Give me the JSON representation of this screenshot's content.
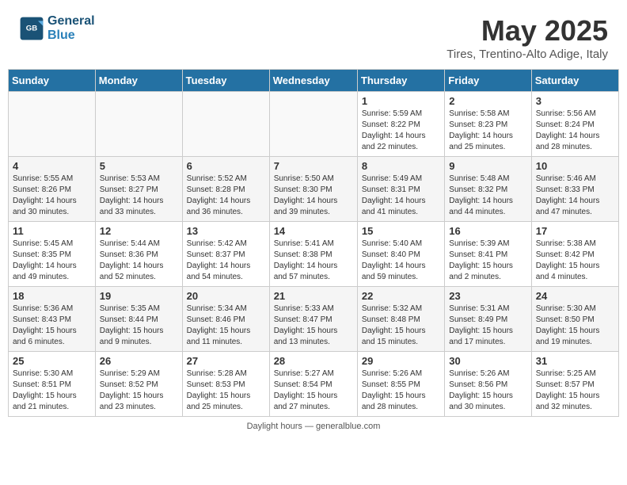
{
  "header": {
    "logo_line1": "General",
    "logo_line2": "Blue",
    "month_year": "May 2025",
    "location": "Tires, Trentino-Alto Adige, Italy"
  },
  "weekdays": [
    "Sunday",
    "Monday",
    "Tuesday",
    "Wednesday",
    "Thursday",
    "Friday",
    "Saturday"
  ],
  "weeks": [
    [
      {
        "day": "",
        "info": ""
      },
      {
        "day": "",
        "info": ""
      },
      {
        "day": "",
        "info": ""
      },
      {
        "day": "",
        "info": ""
      },
      {
        "day": "1",
        "info": "Sunrise: 5:59 AM\nSunset: 8:22 PM\nDaylight: 14 hours\nand 22 minutes."
      },
      {
        "day": "2",
        "info": "Sunrise: 5:58 AM\nSunset: 8:23 PM\nDaylight: 14 hours\nand 25 minutes."
      },
      {
        "day": "3",
        "info": "Sunrise: 5:56 AM\nSunset: 8:24 PM\nDaylight: 14 hours\nand 28 minutes."
      }
    ],
    [
      {
        "day": "4",
        "info": "Sunrise: 5:55 AM\nSunset: 8:26 PM\nDaylight: 14 hours\nand 30 minutes."
      },
      {
        "day": "5",
        "info": "Sunrise: 5:53 AM\nSunset: 8:27 PM\nDaylight: 14 hours\nand 33 minutes."
      },
      {
        "day": "6",
        "info": "Sunrise: 5:52 AM\nSunset: 8:28 PM\nDaylight: 14 hours\nand 36 minutes."
      },
      {
        "day": "7",
        "info": "Sunrise: 5:50 AM\nSunset: 8:30 PM\nDaylight: 14 hours\nand 39 minutes."
      },
      {
        "day": "8",
        "info": "Sunrise: 5:49 AM\nSunset: 8:31 PM\nDaylight: 14 hours\nand 41 minutes."
      },
      {
        "day": "9",
        "info": "Sunrise: 5:48 AM\nSunset: 8:32 PM\nDaylight: 14 hours\nand 44 minutes."
      },
      {
        "day": "10",
        "info": "Sunrise: 5:46 AM\nSunset: 8:33 PM\nDaylight: 14 hours\nand 47 minutes."
      }
    ],
    [
      {
        "day": "11",
        "info": "Sunrise: 5:45 AM\nSunset: 8:35 PM\nDaylight: 14 hours\nand 49 minutes."
      },
      {
        "day": "12",
        "info": "Sunrise: 5:44 AM\nSunset: 8:36 PM\nDaylight: 14 hours\nand 52 minutes."
      },
      {
        "day": "13",
        "info": "Sunrise: 5:42 AM\nSunset: 8:37 PM\nDaylight: 14 hours\nand 54 minutes."
      },
      {
        "day": "14",
        "info": "Sunrise: 5:41 AM\nSunset: 8:38 PM\nDaylight: 14 hours\nand 57 minutes."
      },
      {
        "day": "15",
        "info": "Sunrise: 5:40 AM\nSunset: 8:40 PM\nDaylight: 14 hours\nand 59 minutes."
      },
      {
        "day": "16",
        "info": "Sunrise: 5:39 AM\nSunset: 8:41 PM\nDaylight: 15 hours\nand 2 minutes."
      },
      {
        "day": "17",
        "info": "Sunrise: 5:38 AM\nSunset: 8:42 PM\nDaylight: 15 hours\nand 4 minutes."
      }
    ],
    [
      {
        "day": "18",
        "info": "Sunrise: 5:36 AM\nSunset: 8:43 PM\nDaylight: 15 hours\nand 6 minutes."
      },
      {
        "day": "19",
        "info": "Sunrise: 5:35 AM\nSunset: 8:44 PM\nDaylight: 15 hours\nand 9 minutes."
      },
      {
        "day": "20",
        "info": "Sunrise: 5:34 AM\nSunset: 8:46 PM\nDaylight: 15 hours\nand 11 minutes."
      },
      {
        "day": "21",
        "info": "Sunrise: 5:33 AM\nSunset: 8:47 PM\nDaylight: 15 hours\nand 13 minutes."
      },
      {
        "day": "22",
        "info": "Sunrise: 5:32 AM\nSunset: 8:48 PM\nDaylight: 15 hours\nand 15 minutes."
      },
      {
        "day": "23",
        "info": "Sunrise: 5:31 AM\nSunset: 8:49 PM\nDaylight: 15 hours\nand 17 minutes."
      },
      {
        "day": "24",
        "info": "Sunrise: 5:30 AM\nSunset: 8:50 PM\nDaylight: 15 hours\nand 19 minutes."
      }
    ],
    [
      {
        "day": "25",
        "info": "Sunrise: 5:30 AM\nSunset: 8:51 PM\nDaylight: 15 hours\nand 21 minutes."
      },
      {
        "day": "26",
        "info": "Sunrise: 5:29 AM\nSunset: 8:52 PM\nDaylight: 15 hours\nand 23 minutes."
      },
      {
        "day": "27",
        "info": "Sunrise: 5:28 AM\nSunset: 8:53 PM\nDaylight: 15 hours\nand 25 minutes."
      },
      {
        "day": "28",
        "info": "Sunrise: 5:27 AM\nSunset: 8:54 PM\nDaylight: 15 hours\nand 27 minutes."
      },
      {
        "day": "29",
        "info": "Sunrise: 5:26 AM\nSunset: 8:55 PM\nDaylight: 15 hours\nand 28 minutes."
      },
      {
        "day": "30",
        "info": "Sunrise: 5:26 AM\nSunset: 8:56 PM\nDaylight: 15 hours\nand 30 minutes."
      },
      {
        "day": "31",
        "info": "Sunrise: 5:25 AM\nSunset: 8:57 PM\nDaylight: 15 hours\nand 32 minutes."
      }
    ]
  ],
  "footer": {
    "text": "Daylight hours",
    "link": "https://www.generalblue.com"
  }
}
